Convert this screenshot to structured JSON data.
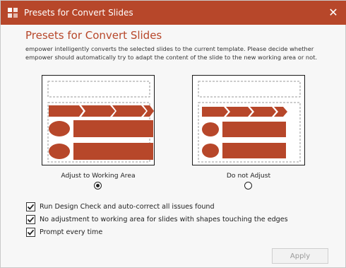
{
  "window": {
    "title": "Presets for Convert Slides",
    "close_glyph": "✕",
    "app_icon": "powerpoint-icon",
    "accent_color": "#b7472a"
  },
  "dialog": {
    "heading": "Presets for Convert Slides",
    "description": "empower intelligently converts the selected slides to the current template. Please decide whether empower should automatically try to adapt the content of the slide to the new working area or not."
  },
  "options": [
    {
      "label": "Adjust to Working Area",
      "selected": true
    },
    {
      "label": "Do not Adjust",
      "selected": false
    }
  ],
  "checkboxes": [
    {
      "label": "Run Design Check and auto-correct all issues found",
      "checked": true
    },
    {
      "label": "No adjustment to working area for slides with shapes touching the edges",
      "checked": true
    },
    {
      "label": "Prompt every time",
      "checked": true
    }
  ],
  "footer": {
    "apply_label": "Apply",
    "apply_enabled": false
  }
}
